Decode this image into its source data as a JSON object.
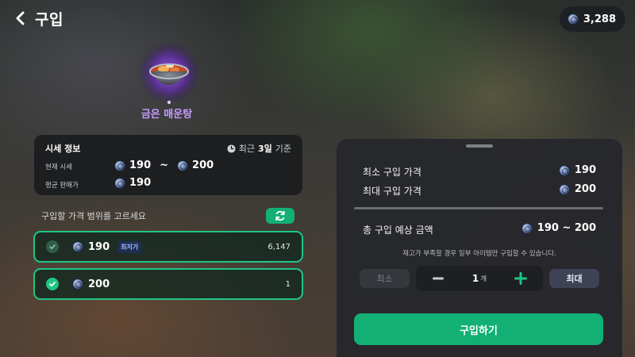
{
  "header": {
    "title": "구입",
    "currency": "3,288"
  },
  "item": {
    "name": "금은 매운탕"
  },
  "market": {
    "title": "시세 정보",
    "basis_prefix": "최근",
    "basis_days": "3일",
    "basis_suffix": "기준",
    "current_label": "현재 시세",
    "current_min": "190",
    "current_sep": "~",
    "current_max": "200",
    "avg_label": "평균 판매가",
    "avg_value": "190"
  },
  "range": {
    "label": "구입할 가격 범위를 고르세요",
    "options": [
      {
        "price": "190",
        "badge": "최저가",
        "qty": "6,147"
      },
      {
        "price": "200",
        "qty": "1"
      }
    ]
  },
  "panel": {
    "min_price_label": "최소 구입 가격",
    "min_price_value": "190",
    "max_price_label": "최대 구입 가격",
    "max_price_value": "200",
    "total_label": "총 구입 예상 금액",
    "total_value": "190 ~ 200",
    "notice": "재고가 부족할 경우 일부 아이템만 구입할 수 있습니다.",
    "min_button": "최소",
    "quantity": "1",
    "quantity_unit": "개",
    "max_button": "최대",
    "buy_button": "구입하기"
  },
  "icons": {
    "back": "chevron-left-icon",
    "coin": "coin-icon",
    "clock": "clock-icon",
    "refresh": "refresh-icon",
    "check": "check-icon",
    "minus": "minus-icon",
    "plus": "plus-icon"
  },
  "colors": {
    "accent": "#12b074",
    "item_name": "#c79dff",
    "selection_border": "#1fc585"
  }
}
